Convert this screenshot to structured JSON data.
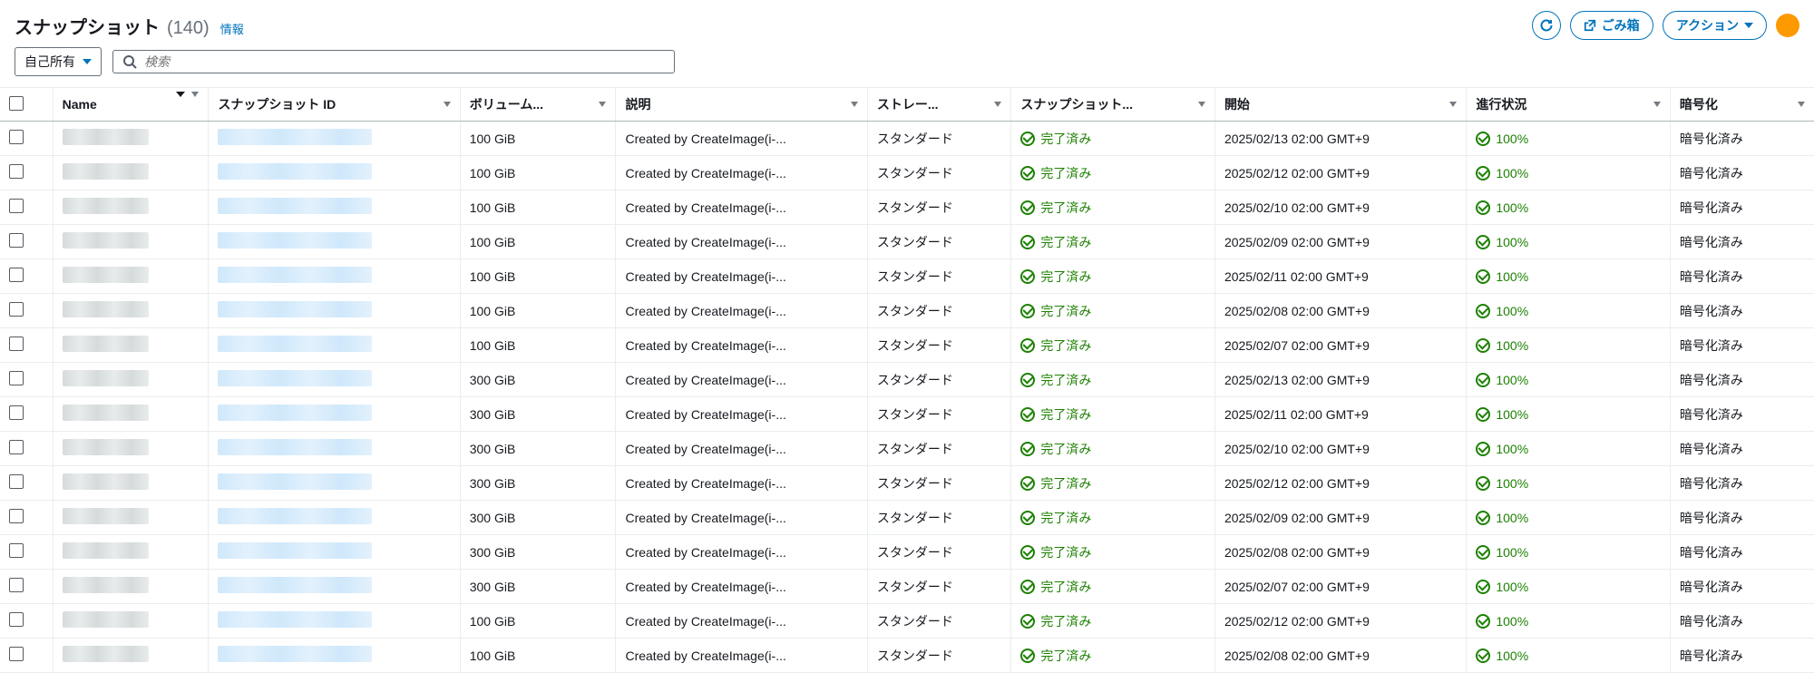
{
  "header": {
    "title": "スナップショット",
    "count": "(140)",
    "info_link": "情報",
    "refresh_label": "更新",
    "trash_label": "ごみ箱",
    "actions_label": "アクション"
  },
  "filters": {
    "owner_label": "自己所有",
    "search_placeholder": "検索"
  },
  "columns": {
    "name": "Name",
    "snapshot_id": "スナップショット ID",
    "volume": "ボリューム...",
    "description": "説明",
    "storage": "ストレー...",
    "status": "スナップショット...",
    "start": "開始",
    "progress": "進行状況",
    "encryption": "暗号化"
  },
  "row_defaults": {
    "description": "Created by CreateImage(i-...",
    "storage": "スタンダード",
    "status": "完了済み",
    "progress": "100%",
    "encryption": "暗号化済み"
  },
  "rows": [
    {
      "volume": "100 GiB",
      "start": "2025/02/13 02:00 GMT+9"
    },
    {
      "volume": "100 GiB",
      "start": "2025/02/12 02:00 GMT+9"
    },
    {
      "volume": "100 GiB",
      "start": "2025/02/10 02:00 GMT+9"
    },
    {
      "volume": "100 GiB",
      "start": "2025/02/09 02:00 GMT+9"
    },
    {
      "volume": "100 GiB",
      "start": "2025/02/11 02:00 GMT+9"
    },
    {
      "volume": "100 GiB",
      "start": "2025/02/08 02:00 GMT+9"
    },
    {
      "volume": "100 GiB",
      "start": "2025/02/07 02:00 GMT+9"
    },
    {
      "volume": "300 GiB",
      "start": "2025/02/13 02:00 GMT+9"
    },
    {
      "volume": "300 GiB",
      "start": "2025/02/11 02:00 GMT+9"
    },
    {
      "volume": "300 GiB",
      "start": "2025/02/10 02:00 GMT+9"
    },
    {
      "volume": "300 GiB",
      "start": "2025/02/12 02:00 GMT+9"
    },
    {
      "volume": "300 GiB",
      "start": "2025/02/09 02:00 GMT+9"
    },
    {
      "volume": "300 GiB",
      "start": "2025/02/08 02:00 GMT+9"
    },
    {
      "volume": "300 GiB",
      "start": "2025/02/07 02:00 GMT+9"
    },
    {
      "volume": "100 GiB",
      "start": "2025/02/12 02:00 GMT+9"
    },
    {
      "volume": "100 GiB",
      "start": "2025/02/08 02:00 GMT+9"
    }
  ]
}
